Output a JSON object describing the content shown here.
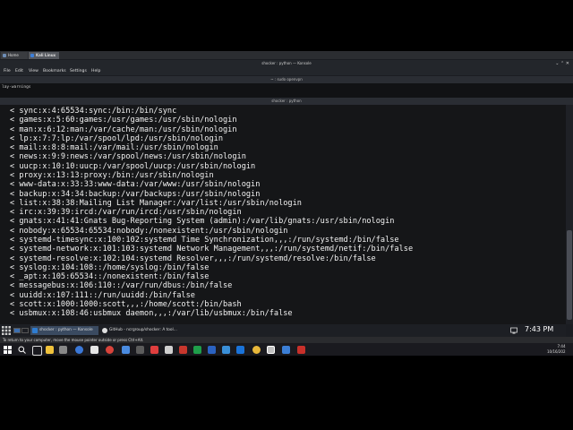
{
  "vm_tabs": [
    {
      "label": "Home",
      "color": "#6d8cb5"
    },
    {
      "label": "Kali Linux",
      "color": "#3d7fd9"
    }
  ],
  "konsole": {
    "title": "shocker : python — Konsole",
    "controls": "⌄ ⌃ ✕",
    "menu": [
      "File",
      "Edit",
      "View",
      "Bookmarks",
      "Settings",
      "Help"
    ],
    "tab1_title": "~ : sudo openvpn",
    "previous_output": "lay-warnings",
    "tab2_title": "shocker : python"
  },
  "terminal_lines": [
    "< sync:x:4:65534:sync:/bin:/bin/sync",
    "< games:x:5:60:games:/usr/games:/usr/sbin/nologin",
    "< man:x:6:12:man:/var/cache/man:/usr/sbin/nologin",
    "< lp:x:7:7:lp:/var/spool/lpd:/usr/sbin/nologin",
    "< mail:x:8:8:mail:/var/mail:/usr/sbin/nologin",
    "< news:x:9:9:news:/var/spool/news:/usr/sbin/nologin",
    "< uucp:x:10:10:uucp:/var/spool/uucp:/usr/sbin/nologin",
    "< proxy:x:13:13:proxy:/bin:/usr/sbin/nologin",
    "< www-data:x:33:33:www-data:/var/www:/usr/sbin/nologin",
    "< backup:x:34:34:backup:/var/backups:/usr/sbin/nologin",
    "< list:x:38:38:Mailing List Manager:/var/list:/usr/sbin/nologin",
    "< irc:x:39:39:ircd:/var/run/ircd:/usr/sbin/nologin",
    "< gnats:x:41:41:Gnats Bug-Reporting System (admin):/var/lib/gnats:/usr/sbin/nologin",
    "< nobody:x:65534:65534:nobody:/nonexistent:/usr/sbin/nologin",
    "< systemd-timesync:x:100:102:systemd Time Synchronization,,,:/run/systemd:/bin/false",
    "< systemd-network:x:101:103:systemd Network Management,,,:/run/systemd/netif:/bin/false",
    "< systemd-resolve:x:102:104:systemd Resolver,,,:/run/systemd/resolve:/bin/false",
    "< syslog:x:104:108::/home/syslog:/bin/false",
    "< _apt:x:105:65534::/nonexistent:/bin/false",
    "< messagebus:x:106:110::/var/run/dbus:/bin/false",
    "< uuidd:x:107:111::/run/uuidd:/bin/false",
    "< scott:x:1000:1000:scott,,,:/home/scott:/bin/bash",
    "< usbmux:x:108:46:usbmux daemon,,,:/var/lib/usbmux:/bin/false"
  ],
  "kde_panel": {
    "tasks": [
      {
        "label": "shocker : python — Konsole",
        "color": "#2f7dd1"
      },
      {
        "label": "GitHub - ncrgroup/shocker: A tool...",
        "color": "#e0e0e0"
      }
    ],
    "clock": "7:43 PM"
  },
  "hint_bar": "To return to your computer, move the mouse pointer outside or press Ctrl+Alt.",
  "windows_taskbar": {
    "time": "7:44",
    "date": "10/16/202"
  }
}
